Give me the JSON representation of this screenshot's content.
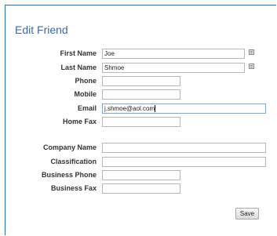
{
  "title": "Edit Friend",
  "fields": {
    "first_name": {
      "label": "First Name",
      "value": "Joe"
    },
    "last_name": {
      "label": "Last Name",
      "value": "Shmoe"
    },
    "phone": {
      "label": "Phone",
      "value": ""
    },
    "mobile": {
      "label": "Mobile",
      "value": ""
    },
    "email": {
      "label": "Email",
      "value": "j.shmoe@aol.com"
    },
    "home_fax": {
      "label": "Home Fax",
      "value": ""
    },
    "company_name": {
      "label": "Company Name",
      "value": ""
    },
    "classification": {
      "label": "Classification",
      "value": ""
    },
    "business_phone": {
      "label": "Business Phone",
      "value": ""
    },
    "business_fax": {
      "label": "Business Fax",
      "value": ""
    }
  },
  "icons": {
    "first_name_card": "contact-card-icon",
    "last_name_card": "contact-card-icon"
  },
  "colors": {
    "title": "#3d6aa8",
    "border": "#2a6bb8"
  },
  "save_label": "Save"
}
